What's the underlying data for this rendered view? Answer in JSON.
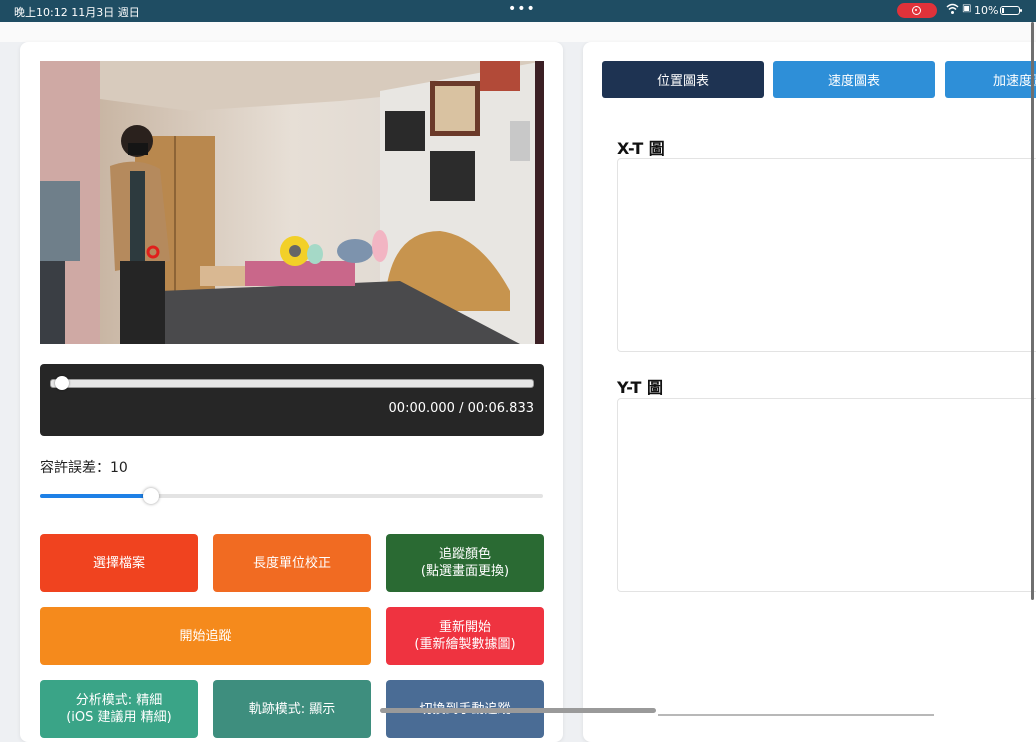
{
  "status_bar": {
    "time": "晚上10:12   11月3日 週日",
    "dots": "•••",
    "battery": "10%"
  },
  "player": {
    "time_display": "00:00.000 / 00:06.833",
    "progress": 0.0
  },
  "tolerance": {
    "label": "容許誤差：10",
    "value": 10,
    "slider_fraction": 0.22
  },
  "buttons": {
    "select_file": "選擇檔案",
    "calibrate": "長度單位校正",
    "track_color": "追蹤顏色\n(點選畫面更換)",
    "start_tracking": "開始追蹤",
    "restart": "重新開始\n(重新繪製數據圖)",
    "analysis_mode": "分析模式: 精細\n(iOS 建議用 精細)",
    "trajectory_mode": "軌跡模式: 顯示",
    "manual_tracking": "切換到手動追蹤"
  },
  "tabs": {
    "position": "位置圖表",
    "velocity": "速度圖表",
    "acceleration": "加速度圖"
  },
  "charts": {
    "xt_title": "X-T 圖",
    "yt_title": "Y-T 圖"
  },
  "colors": {
    "select_file": "#f0431f",
    "calibrate": "#f16b22",
    "track_color": "#2a6a33",
    "start_tracking": "#f58a1c",
    "restart": "#ef3340",
    "analysis_mode": "#3aa487",
    "trajectory_mode": "#3e8e7e",
    "manual_tracking": "#4a6c95",
    "tab_active": "#1e3352",
    "tab_inactive": "#2e8fd8"
  }
}
